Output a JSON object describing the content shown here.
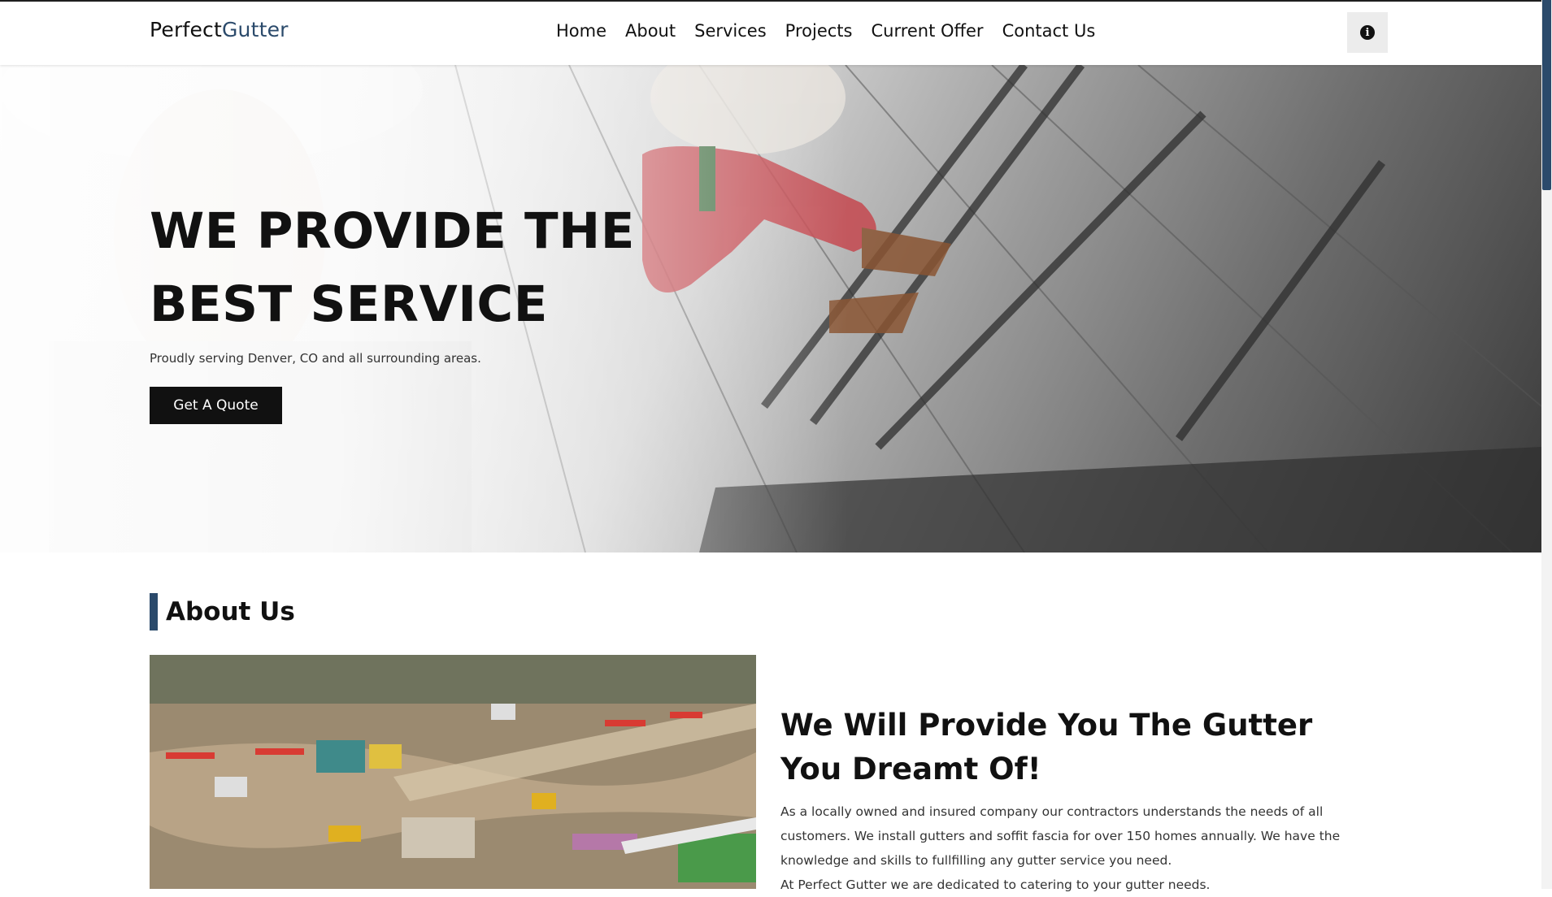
{
  "brand": {
    "part1": "Perfect",
    "part2": "Gutter"
  },
  "nav": {
    "items": [
      {
        "label": "Home"
      },
      {
        "label": "About"
      },
      {
        "label": "Services"
      },
      {
        "label": "Projects"
      },
      {
        "label": "Current Offer"
      },
      {
        "label": "Contact Us"
      }
    ]
  },
  "header": {
    "info_icon": "info-circle-icon"
  },
  "hero": {
    "title_line1": "WE PROVIDE THE",
    "title_line2": "BEST SERVICE",
    "subtitle": "Proudly serving Denver, CO and all surrounding areas.",
    "cta_label": "Get A Quote"
  },
  "about": {
    "heading": "About Us",
    "title": "We Will Provide You The Gutter You Dreamt Of!",
    "paragraph": "As a locally owned and insured company our contractors understands the needs of all customers. We install gutters and soffit fascia for over 150 homes annually. We have the knowledge and skills to fullfilling any gutter service you need.",
    "paragraph2": "At Perfect Gutter we are dedicated to catering to your gutter needs."
  },
  "colors": {
    "accent": "#2b4a6b",
    "button": "#111111",
    "text": "#111111"
  }
}
